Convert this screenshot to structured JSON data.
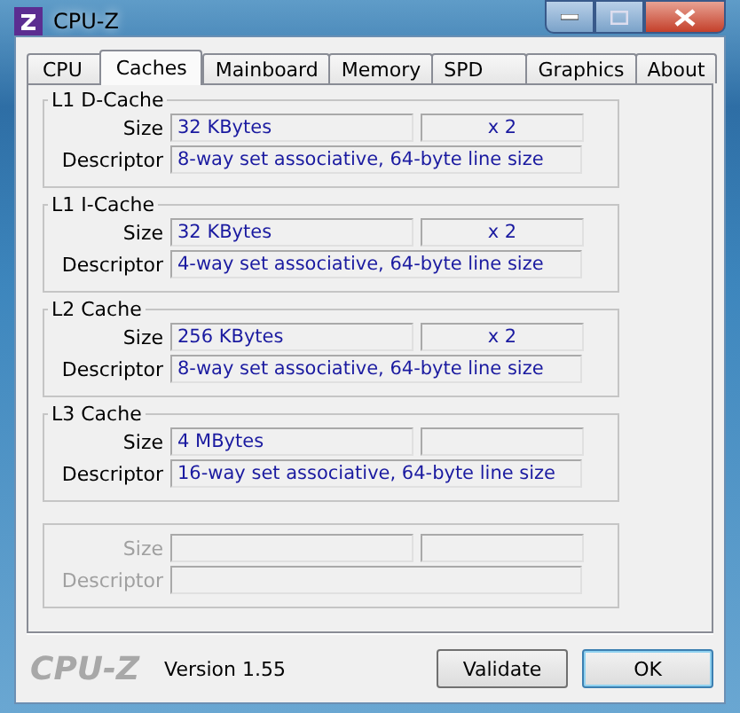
{
  "window": {
    "title": "CPU-Z"
  },
  "tabs": [
    {
      "label": "CPU",
      "selected": false
    },
    {
      "label": "Caches",
      "selected": true
    },
    {
      "label": "Mainboard",
      "selected": false
    },
    {
      "label": "Memory",
      "selected": false
    },
    {
      "label": "SPD",
      "selected": false
    },
    {
      "label": "Graphics",
      "selected": false
    },
    {
      "label": "About",
      "selected": false
    }
  ],
  "caches": [
    {
      "title": "L1 D-Cache",
      "disabled": false,
      "size_label": "Size",
      "size": "32 KBytes",
      "count": "x 2",
      "descriptor_label": "Descriptor",
      "descriptor": "8-way set associative, 64-byte line size"
    },
    {
      "title": "L1 I-Cache",
      "disabled": false,
      "size_label": "Size",
      "size": "32 KBytes",
      "count": "x 2",
      "descriptor_label": "Descriptor",
      "descriptor": "4-way set associative, 64-byte line size"
    },
    {
      "title": "L2 Cache",
      "disabled": false,
      "size_label": "Size",
      "size": "256 KBytes",
      "count": "x 2",
      "descriptor_label": "Descriptor",
      "descriptor": "8-way set associative, 64-byte line size"
    },
    {
      "title": "L3 Cache",
      "disabled": false,
      "size_label": "Size",
      "size": "4 MBytes",
      "descriptor_label": "Descriptor",
      "descriptor": "16-way set associative, 64-byte line size"
    },
    {
      "disabled": true,
      "size_label": "Size",
      "descriptor_label": "Descriptor"
    }
  ],
  "footer": {
    "logo": "CPU-Z",
    "version": "Version 1.55",
    "buttons": [
      "Validate",
      "OK"
    ]
  }
}
